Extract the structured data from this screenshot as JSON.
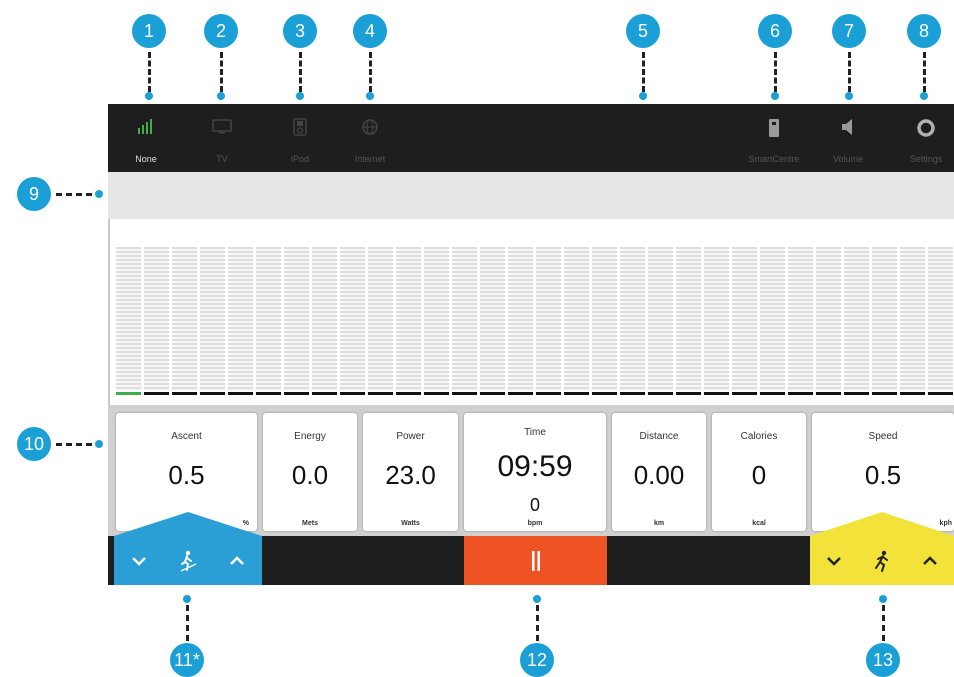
{
  "callouts": [
    "1",
    "2",
    "3",
    "4",
    "5",
    "6",
    "7",
    "8",
    "9",
    "10",
    "11*",
    "12",
    "13"
  ],
  "topbar": {
    "sources": [
      {
        "label": "None",
        "icon": "signal-bars-icon",
        "active": true
      },
      {
        "label": "TV",
        "icon": "tv-icon",
        "active": false
      },
      {
        "label": "iPod",
        "icon": "ipod-icon",
        "active": false
      },
      {
        "label": "Internet",
        "icon": "globe-icon",
        "active": false
      }
    ],
    "right": [
      {
        "label": "SmartCentre",
        "icon": "smartcentre-icon"
      },
      {
        "label": "Volume",
        "icon": "volume-icon"
      },
      {
        "label": "Settings",
        "icon": "gear-icon"
      }
    ]
  },
  "graph": {
    "bar_count": 30,
    "current_index": 0
  },
  "metrics": [
    {
      "title": "Ascent",
      "value": "0.5",
      "unit": "%"
    },
    {
      "title": "Energy",
      "value": "0.0",
      "unit": "Mets"
    },
    {
      "title": "Power",
      "value": "23.0",
      "unit": "Watts"
    },
    {
      "title": "Time",
      "value": "09:59",
      "heart_rate": "0",
      "unit": "bpm"
    },
    {
      "title": "Distance",
      "value": "0.00",
      "unit": "km"
    },
    {
      "title": "Calories",
      "value": "0",
      "unit": "kcal"
    },
    {
      "title": "Speed",
      "value": "0.5",
      "unit": "kph"
    }
  ],
  "controls": {
    "incline": {
      "down": "chevron-down-icon",
      "icon": "incline-walker-icon",
      "up": "chevron-up-icon"
    },
    "pause": {
      "icon": "pause-icon"
    },
    "speed": {
      "down": "chevron-down-icon",
      "icon": "runner-icon",
      "up": "chevron-up-icon"
    }
  },
  "colors": {
    "callout": "#1a9fd6",
    "incline": "#2a9fd5",
    "pause": "#f05323",
    "speed": "#f2e23a",
    "active_green": "#3fae49"
  }
}
